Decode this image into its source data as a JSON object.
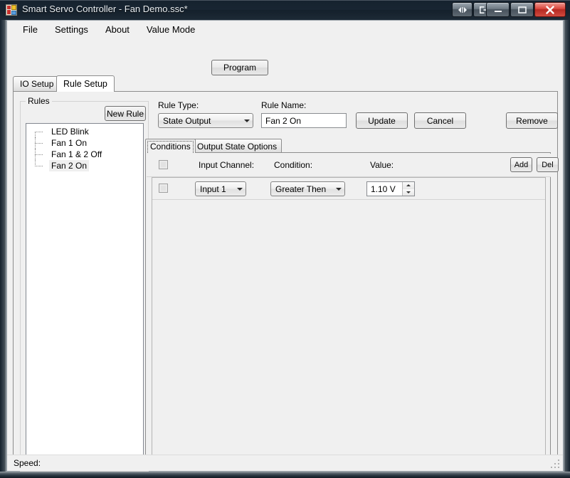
{
  "window": {
    "title": "Smart Servo Controller - Fan Demo.ssc*",
    "icon": "app-icon",
    "controls": {
      "extra1": "left-right-arrows-icon",
      "extra2": "exit-icon",
      "minimize": "minimize-icon",
      "maximize": "maximize-icon",
      "close": "close-icon"
    },
    "accent_close": "#d9453b",
    "titlebar_color": "#16222e"
  },
  "menu": {
    "items": [
      {
        "label": "File"
      },
      {
        "label": "Settings"
      },
      {
        "label": "About"
      },
      {
        "label": "Value Mode"
      }
    ]
  },
  "toolbar": {
    "program_label": "Program"
  },
  "main_tabs": {
    "items": [
      {
        "label": "IO Setup",
        "selected": false
      },
      {
        "label": "Rule Setup",
        "selected": true
      }
    ]
  },
  "rules_group": {
    "title": "Rules",
    "new_rule_label": "New Rule",
    "items": [
      {
        "label": "LED Blink",
        "selected": false
      },
      {
        "label": "Fan 1 On",
        "selected": false
      },
      {
        "label": "Fan 1 & 2 Off",
        "selected": false
      },
      {
        "label": "Fan 2 On",
        "selected": true
      }
    ]
  },
  "rule_form": {
    "rule_type_label": "Rule Type:",
    "rule_type_value": "State Output",
    "rule_name_label": "Rule Name:",
    "rule_name_value": "Fan 2 On",
    "update_label": "Update",
    "cancel_label": "Cancel",
    "remove_label": "Remove"
  },
  "inner_tabs": {
    "items": [
      {
        "label": "Conditions",
        "selected": true
      },
      {
        "label": "Output State Options",
        "selected": false
      }
    ]
  },
  "conditions_grid": {
    "columns": [
      {
        "label": "Input Channel:"
      },
      {
        "label": "Condition:"
      },
      {
        "label": "Value:"
      }
    ],
    "add_label": "Add",
    "del_label": "Del",
    "rows": [
      {
        "input_channel": "Input 1",
        "condition": "Greater Then",
        "value": "1.10 V"
      }
    ]
  },
  "statusbar": {
    "text": "Speed:"
  }
}
